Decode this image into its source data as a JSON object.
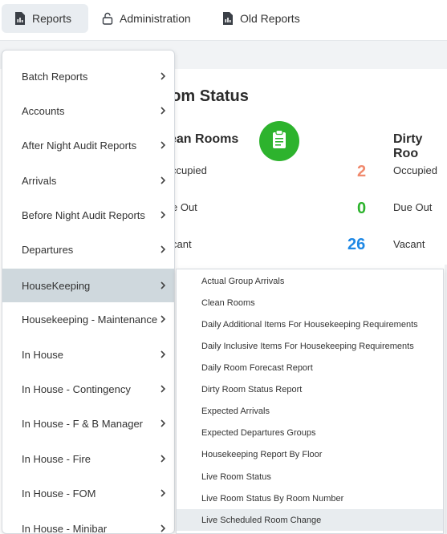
{
  "nav": {
    "tabs": [
      {
        "label": "Reports",
        "icon": "report-file-icon",
        "active": true
      },
      {
        "label": "Administration",
        "icon": "lock-icon",
        "active": false
      },
      {
        "label": "Old Reports",
        "icon": "report-file-icon",
        "active": false
      }
    ]
  },
  "dashboard": {
    "title": "oom Status",
    "clean_panel": {
      "title": "ean Rooms",
      "rows": [
        {
          "label": "ccupied",
          "value": "2",
          "color": "#f08a6e"
        },
        {
          "label": "e Out",
          "value": "0",
          "color": "#2db32d"
        },
        {
          "label": "cant",
          "value": "26",
          "color": "#1e88e5"
        }
      ]
    },
    "dirty_panel": {
      "title": "Dirty Roo",
      "rows": [
        {
          "label": "Occupied"
        },
        {
          "label": "Due Out"
        },
        {
          "label": "Vacant"
        }
      ]
    },
    "badge_icon": "clipboard-icon",
    "badge_color": "#2db32d"
  },
  "menu": {
    "items": [
      {
        "label": "Batch Reports"
      },
      {
        "label": "Accounts"
      },
      {
        "label": "After Night Audit Reports"
      },
      {
        "label": "Arrivals"
      },
      {
        "label": "Before Night Audit Reports"
      },
      {
        "label": "Departures"
      },
      {
        "label": "HouseKeeping",
        "active": true
      },
      {
        "label": "Housekeeping - Maintenance"
      },
      {
        "label": "In House"
      },
      {
        "label": "In House - Contingency"
      },
      {
        "label": "In House - F & B Manager"
      },
      {
        "label": "In House - Fire"
      },
      {
        "label": "In House - FOM"
      },
      {
        "label": "In House - Minibar"
      }
    ]
  },
  "submenu": {
    "items": [
      {
        "label": "Actual Group Arrivals"
      },
      {
        "label": "Clean Rooms"
      },
      {
        "label": "Daily Additional Items For Housekeeping Requirements"
      },
      {
        "label": "Daily Inclusive Items For Housekeeping Requirements"
      },
      {
        "label": "Daily Room Forecast Report"
      },
      {
        "label": "Dirty Room Status Report"
      },
      {
        "label": "Expected Arrivals"
      },
      {
        "label": "Expected Departures Groups"
      },
      {
        "label": "Housekeeping Report By Floor"
      },
      {
        "label": "Live Room Status"
      },
      {
        "label": "Live Room Status By Room Number"
      },
      {
        "label": "Live Scheduled Room Change",
        "hover": true
      }
    ]
  }
}
